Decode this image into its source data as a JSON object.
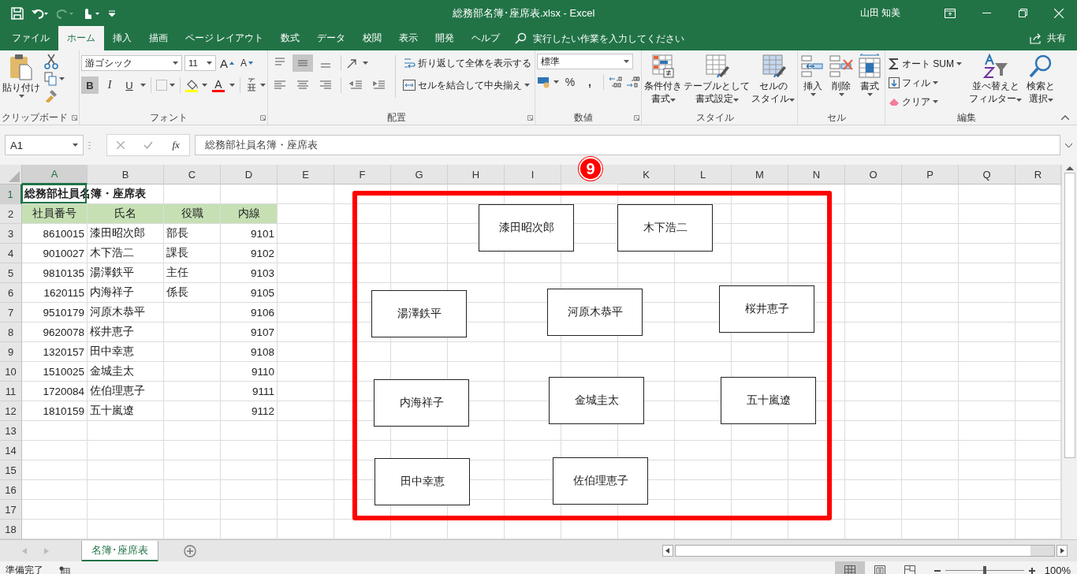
{
  "title_bar": {
    "title": "総務部名簿･座席表.xlsx  -  Excel",
    "user": "山田 知美"
  },
  "menu_tabs": [
    {
      "label": "ファイル",
      "selected": false
    },
    {
      "label": "ホーム",
      "selected": true
    },
    {
      "label": "挿入",
      "selected": false
    },
    {
      "label": "描画",
      "selected": false
    },
    {
      "label": "ページ レイアウト",
      "selected": false
    },
    {
      "label": "数式",
      "selected": false
    },
    {
      "label": "データ",
      "selected": false
    },
    {
      "label": "校閲",
      "selected": false
    },
    {
      "label": "表示",
      "selected": false
    },
    {
      "label": "開発",
      "selected": false
    },
    {
      "label": "ヘルプ",
      "selected": false
    }
  ],
  "tell_me": {
    "placeholder": "実行したい作業を入力してください"
  },
  "share": "共有",
  "ribbon": {
    "clipboard": {
      "paste": "貼り付け",
      "label": "クリップボード"
    },
    "font": {
      "font_name": "游ゴシック",
      "font_size": "11",
      "grow": "A",
      "shrink": "A",
      "bold": "B",
      "italic": "I",
      "underline": "U",
      "font_color": "A",
      "label": "フォント"
    },
    "alignment": {
      "wrap": "折り返して全体を表示する",
      "merge": "セルを結合して中央揃え",
      "label": "配置"
    },
    "number": {
      "format": "標準",
      "percent": "%",
      "comma": ",",
      "label": "数値"
    },
    "styles": {
      "buttons": [
        {
          "lines": [
            "条件付き",
            "書式"
          ]
        },
        {
          "lines": [
            "テーブルとして",
            "書式設定"
          ]
        },
        {
          "lines": [
            "セルの",
            "スタイル"
          ]
        }
      ],
      "label": "スタイル"
    },
    "cells": {
      "buttons": [
        "挿入",
        "削除",
        "書式"
      ],
      "label": "セル"
    },
    "editing": {
      "autosum": "オート SUM",
      "fill": "フィル",
      "clear": "クリア",
      "sort": [
        "並べ替えと",
        "フィルター"
      ],
      "find": [
        "検索と",
        "選択"
      ],
      "label": "編集"
    }
  },
  "formula_bar": {
    "name_box": "A1",
    "function_label": "fx",
    "formula": "総務部社員名簿・座席表"
  },
  "sheet": {
    "columns": [
      {
        "label": "A",
        "selected": true
      },
      {
        "label": "B",
        "selected": false
      },
      {
        "label": "C",
        "selected": false
      },
      {
        "label": "D",
        "selected": false
      },
      {
        "label": "E",
        "selected": false
      },
      {
        "label": "F",
        "selected": false
      },
      {
        "label": "G",
        "selected": false
      },
      {
        "label": "H",
        "selected": false
      },
      {
        "label": "I",
        "selected": false
      },
      null,
      {
        "label": "K",
        "selected": false
      },
      {
        "label": "L",
        "selected": false
      },
      {
        "label": "M",
        "selected": false
      },
      {
        "label": "N",
        "selected": false
      },
      {
        "label": "O",
        "selected": false
      },
      {
        "label": "P",
        "selected": false
      },
      {
        "label": "Q",
        "selected": false
      },
      {
        "label": "R",
        "selected": false
      }
    ],
    "rows": [
      {
        "number": "1",
        "kind": "title",
        "selected": true,
        "cells": [
          {
            "text": "総務部社員名簿・座席表",
            "selected": true
          }
        ]
      },
      {
        "number": "2",
        "kind": "header",
        "selected": false,
        "cells": [
          {
            "text": "社員番号",
            "selected": false
          },
          {
            "text": "氏名",
            "selected": false
          },
          {
            "text": "役職",
            "selected": false
          },
          {
            "text": "内線",
            "selected": false
          }
        ]
      },
      {
        "number": "3",
        "kind": "data",
        "selected": false,
        "cells": [
          {
            "text": "8610015",
            "selected": false
          },
          {
            "text": "漆田昭次郎",
            "selected": false
          },
          {
            "text": "部長",
            "selected": false
          },
          {
            "text": "9101",
            "selected": false
          }
        ]
      },
      {
        "number": "4",
        "kind": "data",
        "selected": false,
        "cells": [
          {
            "text": "9010027",
            "selected": false
          },
          {
            "text": "木下浩二",
            "selected": false
          },
          {
            "text": "課長",
            "selected": false
          },
          {
            "text": "9102",
            "selected": false
          }
        ]
      },
      {
        "number": "5",
        "kind": "data",
        "selected": false,
        "cells": [
          {
            "text": "9810135",
            "selected": false
          },
          {
            "text": "湯澤鉄平",
            "selected": false
          },
          {
            "text": "主任",
            "selected": false
          },
          {
            "text": "9103",
            "selected": false
          }
        ]
      },
      {
        "number": "6",
        "kind": "data",
        "selected": false,
        "cells": [
          {
            "text": "1620115",
            "selected": false
          },
          {
            "text": "内海祥子",
            "selected": false
          },
          {
            "text": "係長",
            "selected": false
          },
          {
            "text": "9105",
            "selected": false
          }
        ]
      },
      {
        "number": "7",
        "kind": "data",
        "selected": false,
        "cells": [
          {
            "text": "9510179",
            "selected": false
          },
          {
            "text": "河原木恭平",
            "selected": false
          },
          null,
          {
            "text": "9106",
            "selected": false
          }
        ]
      },
      {
        "number": "8",
        "kind": "data",
        "selected": false,
        "cells": [
          {
            "text": "9620078",
            "selected": false
          },
          {
            "text": "桜井恵子",
            "selected": false
          },
          null,
          {
            "text": "9107",
            "selected": false
          }
        ]
      },
      {
        "number": "9",
        "kind": "data",
        "selected": false,
        "cells": [
          {
            "text": "1320157",
            "selected": false
          },
          {
            "text": "田中幸恵",
            "selected": false
          },
          null,
          {
            "text": "9108",
            "selected": false
          }
        ]
      },
      {
        "number": "10",
        "kind": "data",
        "selected": false,
        "cells": [
          {
            "text": "1510025",
            "selected": false
          },
          {
            "text": "金城圭太",
            "selected": false
          },
          null,
          {
            "text": "9110",
            "selected": false
          }
        ]
      },
      {
        "number": "11",
        "kind": "data",
        "selected": false,
        "cells": [
          {
            "text": "1720084",
            "selected": false
          },
          {
            "text": "佐伯理恵子",
            "selected": false
          },
          null,
          {
            "text": "9111",
            "selected": false
          }
        ]
      },
      {
        "number": "12",
        "kind": "data",
        "selected": false,
        "cells": [
          {
            "text": "1810159",
            "selected": false
          },
          {
            "text": "五十嵐遼",
            "selected": false
          },
          null,
          {
            "text": "9112",
            "selected": false
          }
        ]
      },
      {
        "number": "13",
        "kind": "empty",
        "selected": false
      },
      {
        "number": "14",
        "kind": "empty",
        "selected": false
      },
      {
        "number": "15",
        "kind": "empty",
        "selected": false
      },
      {
        "number": "16",
        "kind": "empty",
        "selected": false
      },
      {
        "number": "17",
        "kind": "empty",
        "selected": false
      },
      {
        "number": "18",
        "kind": "empty",
        "selected": false
      }
    ],
    "seating": {
      "badge": "9",
      "seats": [
        "漆田昭次郎",
        "木下浩二",
        "湯澤鉄平",
        "河原木恭平",
        "桜井恵子",
        "内海祥子",
        "金城圭太",
        "五十嵐遼",
        "田中幸恵",
        "佐伯理恵子"
      ]
    }
  },
  "sheet_tabs": [
    {
      "label": "名簿･座席表",
      "selected": true
    }
  ],
  "status_bar": {
    "text": "準備完了",
    "zoom": "100%",
    "zoom_slider": {
      "level": 0.5
    },
    "views": [
      {
        "kind": "normal",
        "selected": true
      },
      {
        "kind": "page_layout",
        "selected": false
      },
      {
        "kind": "page_break",
        "selected": false
      }
    ]
  }
}
